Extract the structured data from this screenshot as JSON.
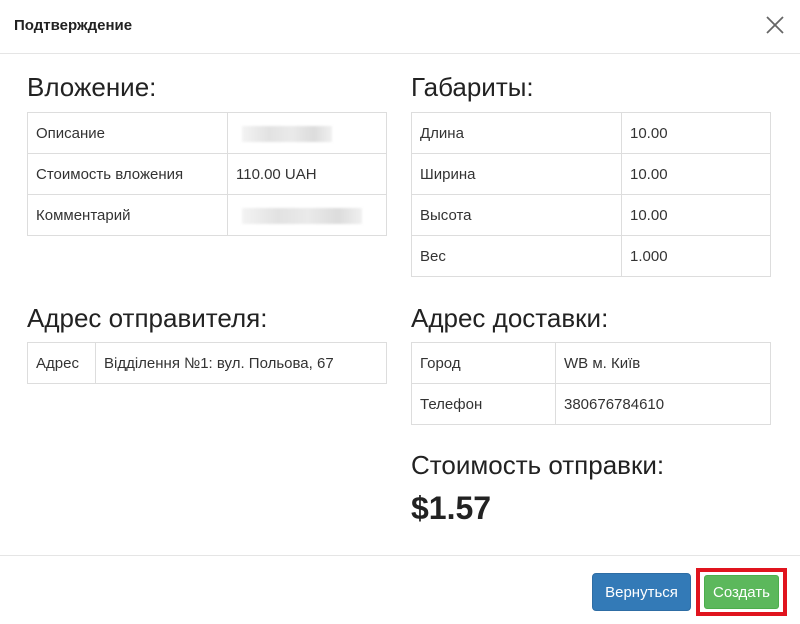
{
  "modal": {
    "title": "Подтверждение"
  },
  "attachment": {
    "heading": "Вложение:",
    "rows": [
      {
        "label": "Описание",
        "value": ""
      },
      {
        "label": "Стоимость вложения",
        "value": "110.00 UAH"
      },
      {
        "label": "Комментарий",
        "value": ""
      }
    ]
  },
  "dimensions": {
    "heading": "Габариты:",
    "rows": [
      {
        "label": "Длина",
        "value": "10.00"
      },
      {
        "label": "Ширина",
        "value": "10.00"
      },
      {
        "label": "Высота",
        "value": "10.00"
      },
      {
        "label": "Вес",
        "value": "1.000"
      }
    ]
  },
  "sender": {
    "heading": "Адрес отправителя:",
    "rows": [
      {
        "label": "Адрес",
        "value": "Відділення №1: вул. Польова, 67"
      }
    ]
  },
  "delivery": {
    "heading": "Адрес доставки:",
    "rows": [
      {
        "label": "Город",
        "value": "WB м. Київ"
      },
      {
        "label": "Телефон",
        "value": "380676784610"
      }
    ]
  },
  "shipping": {
    "heading": "Стоимость отправки:",
    "price": "$1.57"
  },
  "footer": {
    "back_label": "Вернуться",
    "create_label": "Создать"
  },
  "colors": {
    "primary": "#337ab7",
    "success": "#5cb85c",
    "highlight": "#e0141e"
  }
}
